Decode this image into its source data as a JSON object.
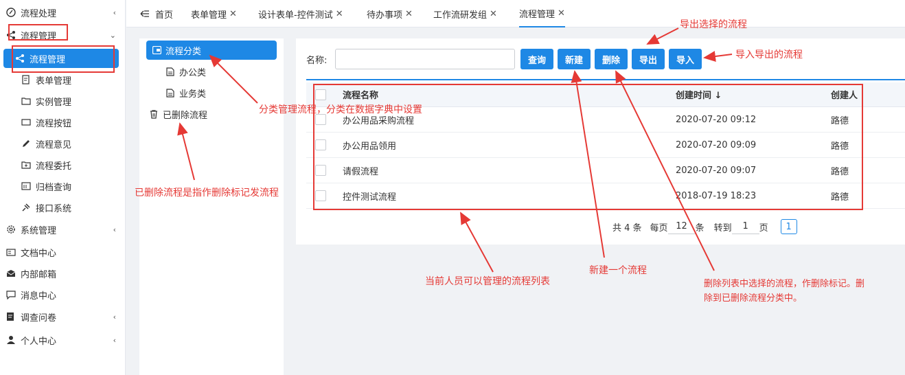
{
  "sidebar": {
    "items": [
      {
        "label": "流程处理",
        "icon": "edit-circle-icon",
        "arrow": "‹"
      },
      {
        "label": "流程管理",
        "icon": "share-icon",
        "arrow": "⌄"
      },
      {
        "label": "流程管理",
        "icon": "share-icon"
      },
      {
        "label": "表单管理",
        "icon": "form-edit-icon"
      },
      {
        "label": "实例管理",
        "icon": "folder-icon"
      },
      {
        "label": "流程按钮",
        "icon": "button-icon"
      },
      {
        "label": "流程意见",
        "icon": "pencil-icon"
      },
      {
        "label": "流程委托",
        "icon": "folder-plus-icon"
      },
      {
        "label": "归档查询",
        "icon": "archive-icon"
      },
      {
        "label": "接口系统",
        "icon": "plug-icon"
      },
      {
        "label": "系统管理",
        "icon": "gear-icon",
        "arrow": "‹"
      },
      {
        "label": "文档中心",
        "icon": "document-icon"
      },
      {
        "label": "内部邮箱",
        "icon": "mail-icon"
      },
      {
        "label": "消息中心",
        "icon": "message-icon"
      },
      {
        "label": "调查问卷",
        "icon": "survey-icon",
        "arrow": "‹"
      },
      {
        "label": "个人中心",
        "icon": "user-icon",
        "arrow": "‹"
      }
    ]
  },
  "tabs": [
    {
      "label": "首页",
      "icon": "menu-fold-icon"
    },
    {
      "label": "表单管理",
      "close": "✕"
    },
    {
      "label": "设计表单-控件测试",
      "close": "✕"
    },
    {
      "label": "待办事项",
      "close": "✕"
    },
    {
      "label": "工作流研发组",
      "close": "✕"
    },
    {
      "label": "流程管理",
      "close": "✕"
    }
  ],
  "tree": {
    "root": "流程分类",
    "children": [
      "办公类",
      "业务类"
    ],
    "deleted": "已删除流程"
  },
  "toolbar": {
    "name_label": "名称:",
    "name_value": "",
    "query": "查询",
    "new": "新建",
    "delete": "删除",
    "export": "导出",
    "import": "导入"
  },
  "table": {
    "columns": [
      "流程名称",
      "创建时间 ↓",
      "创建人"
    ],
    "rows": [
      {
        "name": "办公用品采购流程",
        "time": "2020-07-20 09:12",
        "creator": "路德"
      },
      {
        "name": "办公用品领用",
        "time": "2020-07-20 09:09",
        "creator": "路德"
      },
      {
        "name": "请假流程",
        "time": "2020-07-20 09:07",
        "creator": "路德"
      },
      {
        "name": "控件测试流程",
        "time": "2018-07-19 18:23",
        "creator": "路德"
      }
    ]
  },
  "pager": {
    "total": "共 4 条",
    "per_page_label": "每页",
    "per_page_value": "12",
    "per_page_unit": "条",
    "goto_label": "转到",
    "goto_value": "1",
    "goto_unit": "页",
    "current_page": "1"
  },
  "annotations": {
    "export": "导出选择的流程",
    "import": "导入导出的流程",
    "category": "分类管理流程，分类在数据字典中设置",
    "deleted": "已删除流程是指作删除标记发流程",
    "list": "当前人员可以管理的流程列表",
    "new": "新建一个流程",
    "delete_line1": "删除列表中选择的流程，作删除标记。删",
    "delete_line2": "除到已删除流程分类中。"
  },
  "colors": {
    "accent": "#1e88e5",
    "annotation": "#e53935"
  }
}
